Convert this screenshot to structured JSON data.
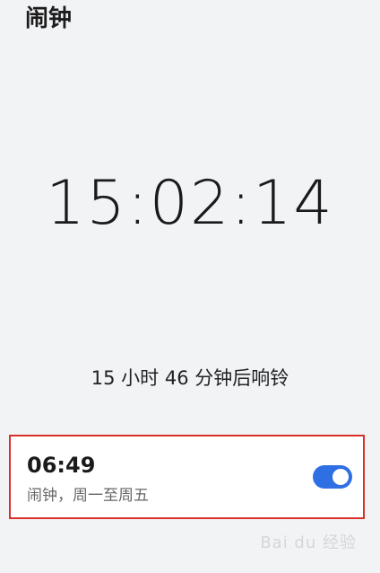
{
  "header": {
    "title": "闹钟"
  },
  "clock": {
    "current_time": "15:02:14"
  },
  "next_alarm": {
    "countdown_text": "15 小时 46 分钟后响铃"
  },
  "alarms": [
    {
      "time": "06:49",
      "description": "闹钟，周一至周五",
      "enabled": true
    }
  ],
  "watermark": {
    "text": "Bai du 经验"
  },
  "colors": {
    "background": "#f1f3f5",
    "toggle_on": "#2f6fe4",
    "highlight_border": "#d9302c"
  }
}
